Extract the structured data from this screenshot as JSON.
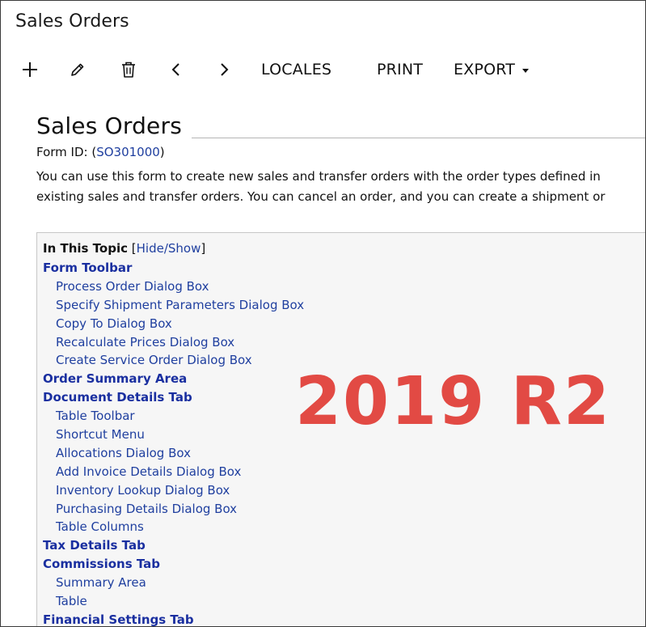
{
  "window": {
    "title": "Sales Orders"
  },
  "toolbar": {
    "add_icon": "plus-icon",
    "edit_icon": "pencil-icon",
    "delete_icon": "trash-icon",
    "prev_icon": "chevron-left-icon",
    "next_icon": "chevron-right-icon",
    "locales_label": "LOCALES",
    "print_label": "PRINT",
    "export_label": "EXPORT"
  },
  "document": {
    "title": "Sales Orders",
    "form_id_prefix": "Form ID: (",
    "form_id_value": "SO301000",
    "form_id_suffix": ")",
    "description_line1": "You can use this form to create new sales and transfer orders with the order types defined in",
    "description_line2": "existing sales and transfer orders. You can cancel an order, and you can create a shipment or"
  },
  "toc": {
    "heading": "In This Topic",
    "toggle_open": "[",
    "toggle_label": "Hide/Show",
    "toggle_close": "]",
    "items": [
      {
        "label": "Form Toolbar",
        "level": 0
      },
      {
        "label": "Process Order Dialog Box",
        "level": 1
      },
      {
        "label": "Specify Shipment Parameters Dialog Box",
        "level": 1
      },
      {
        "label": "Copy To Dialog Box",
        "level": 1
      },
      {
        "label": "Recalculate Prices Dialog Box",
        "level": 1
      },
      {
        "label": "Create Service Order Dialog Box",
        "level": 1
      },
      {
        "label": "Order Summary Area",
        "level": 0
      },
      {
        "label": "Document Details Tab",
        "level": 0
      },
      {
        "label": "Table Toolbar",
        "level": 1
      },
      {
        "label": "Shortcut Menu",
        "level": 1
      },
      {
        "label": "Allocations Dialog Box",
        "level": 1
      },
      {
        "label": "Add Invoice Details Dialog Box",
        "level": 1
      },
      {
        "label": "Inventory Lookup Dialog Box",
        "level": 1
      },
      {
        "label": "Purchasing Details Dialog Box",
        "level": 1
      },
      {
        "label": "Table Columns",
        "level": 1
      },
      {
        "label": "Tax Details Tab",
        "level": 0
      },
      {
        "label": "Commissions Tab",
        "level": 0
      },
      {
        "label": "Summary Area",
        "level": 1
      },
      {
        "label": "Table",
        "level": 1
      },
      {
        "label": "Financial Settings Tab",
        "level": 0
      }
    ]
  },
  "watermark": {
    "text": "2019 R2",
    "color": "#e24a44"
  },
  "colors": {
    "link": "#1f3f9f",
    "toc_background": "#f6f6f6"
  }
}
